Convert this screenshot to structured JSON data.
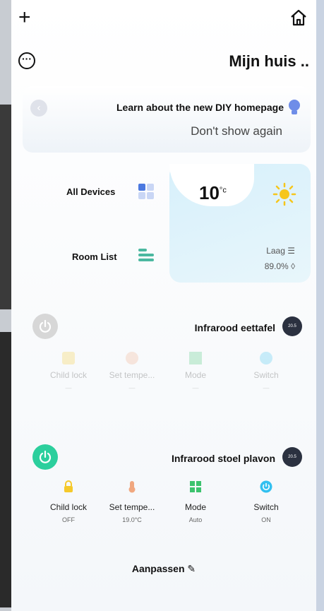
{
  "header": {
    "title": "Mijn huis ..",
    "add_icon": "plus-icon",
    "home_icon": "home-icon",
    "more_icon": "more-icon"
  },
  "learn_card": {
    "text": "Learn about the new DIY homepage",
    "dismiss": "Don't show again"
  },
  "shortcuts": {
    "all_devices": "All Devices",
    "room_list": "Room List"
  },
  "weather": {
    "temperature": "10",
    "unit": "°c",
    "level": "Laag",
    "humidity": "89.0%"
  },
  "devices": [
    {
      "name": "Infrarood eettafel",
      "power": "off",
      "features": [
        {
          "label": "Switch",
          "value": "—"
        },
        {
          "label": "Mode",
          "value": "—"
        },
        {
          "label": "Set tempe...",
          "value": "—"
        },
        {
          "label": "Child lock",
          "value": "—"
        }
      ]
    },
    {
      "name": "Infrarood stoel plavon",
      "power": "on",
      "features": [
        {
          "label": "Switch",
          "value": "ON"
        },
        {
          "label": "Mode",
          "value": "Auto"
        },
        {
          "label": "Set tempe...",
          "value": "19.0°C"
        },
        {
          "label": "Child lock",
          "value": "OFF"
        }
      ]
    }
  ],
  "footer": {
    "customize": "Aanpassen"
  },
  "colors": {
    "power_on": "#2ccf9d",
    "power_off": "#d7d7d7",
    "accent_blue": "#4b78e0"
  }
}
